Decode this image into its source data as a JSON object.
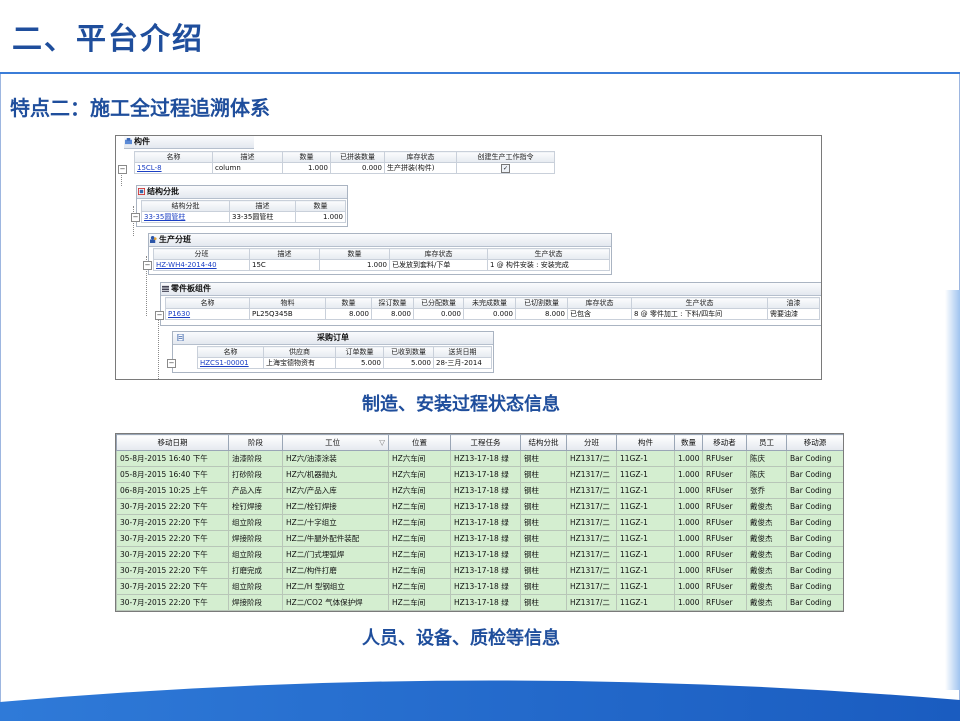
{
  "slide": {
    "title": "二、平台介绍",
    "subtitle": "特点二：施工全过程追溯体系",
    "caption1": "制造、安装过程状态信息",
    "caption2": "人员、设备、质检等信息"
  },
  "s1": {
    "component": {
      "title": "构件",
      "headers": [
        "名称",
        "描述",
        "数量",
        "已拼装数量",
        "库存状态",
        "创建生产工作指令"
      ],
      "row": [
        "15CL-8",
        "column",
        "1.000",
        "0.000",
        "生产拼装(构件)",
        "✓"
      ]
    },
    "batch": {
      "title": "结构分批",
      "headers": [
        "结构分批",
        "描述",
        "数量"
      ],
      "row": [
        "33-35圆管柱",
        "33-35圆管柱",
        "1.000"
      ]
    },
    "team": {
      "title": "生产分班",
      "headers": [
        "分班",
        "描述",
        "数量",
        "库存状态",
        "生产状态"
      ],
      "row": [
        "HZ-WH4-2014-40",
        "15C",
        "1.000",
        "已发放到套料/下单",
        "1 @ 构件安装 : 安装完成"
      ]
    },
    "part": {
      "title": "零件板组件",
      "headers": [
        "名称",
        "物料",
        "数量",
        "採订数量",
        "已分配数量",
        "未完成数量",
        "已切割数量",
        "库存状态",
        "生产状态",
        "油漆"
      ],
      "row": [
        "P1630",
        "PL25Q345B",
        "8.000",
        "8.000",
        "0.000",
        "0.000",
        "8.000",
        "已包含",
        "8 @ 零件加工 : 下料/四车间",
        "需要油漆"
      ]
    },
    "po": {
      "title": "采购订单",
      "headers": [
        "名称",
        "供应商",
        "订单数量",
        "已收到数量",
        "送货日期"
      ],
      "row": [
        "HZCS1-00001",
        "上海宝德物资有",
        "5.000",
        "5.000",
        "28-三月-2014"
      ]
    }
  },
  "s2": {
    "headers": [
      "移动日期",
      "阶段",
      "工位",
      "位置",
      "工程任务",
      "结构分批",
      "分班",
      "构件",
      "数量",
      "移动者",
      "员工",
      "移动源"
    ],
    "rows": [
      [
        "05-8月-2015 16:40 下午",
        "油漆阶段",
        "HZ六/油漆涂装",
        "HZ六车间",
        "HZ13-17-18 绿",
        "钢柱",
        "HZ1317/二",
        "11GZ-1",
        "1.000",
        "RFUser",
        "陈庆",
        "Bar Coding"
      ],
      [
        "05-8月-2015 16:40 下午",
        "打砂阶段",
        "HZ六/机器抛丸",
        "HZ六车间",
        "HZ13-17-18 绿",
        "钢柱",
        "HZ1317/二",
        "11GZ-1",
        "1.000",
        "RFUser",
        "陈庆",
        "Bar Coding"
      ],
      [
        "06-8月-2015 10:25 上午",
        "产品入库",
        "HZ六/产品入库",
        "HZ六车间",
        "HZ13-17-18 绿",
        "钢柱",
        "HZ1317/二",
        "11GZ-1",
        "1.000",
        "RFUser",
        "张乔",
        "Bar Coding"
      ],
      [
        "30-7月-2015 22:20 下午",
        "栓钉焊接",
        "HZ二/栓钉焊接",
        "HZ二车间",
        "HZ13-17-18 绿",
        "钢柱",
        "HZ1317/二",
        "11GZ-1",
        "1.000",
        "RFUser",
        "戴俊杰",
        "Bar Coding"
      ],
      [
        "30-7月-2015 22:20 下午",
        "组立阶段",
        "HZ二/十字组立",
        "HZ二车间",
        "HZ13-17-18 绿",
        "钢柱",
        "HZ1317/二",
        "11GZ-1",
        "1.000",
        "RFUser",
        "戴俊杰",
        "Bar Coding"
      ],
      [
        "30-7月-2015 22:20 下午",
        "焊接阶段",
        "HZ二/牛腿外配件装配",
        "HZ二车间",
        "HZ13-17-18 绿",
        "钢柱",
        "HZ1317/二",
        "11GZ-1",
        "1.000",
        "RFUser",
        "戴俊杰",
        "Bar Coding"
      ],
      [
        "30-7月-2015 22:20 下午",
        "组立阶段",
        "HZ二/门式埋弧焊",
        "HZ二车间",
        "HZ13-17-18 绿",
        "钢柱",
        "HZ1317/二",
        "11GZ-1",
        "1.000",
        "RFUser",
        "戴俊杰",
        "Bar Coding"
      ],
      [
        "30-7月-2015 22:20 下午",
        "打磨完成",
        "HZ二/构件打磨",
        "HZ二车间",
        "HZ13-17-18 绿",
        "钢柱",
        "HZ1317/二",
        "11GZ-1",
        "1.000",
        "RFUser",
        "戴俊杰",
        "Bar Coding"
      ],
      [
        "30-7月-2015 22:20 下午",
        "组立阶段",
        "HZ二/H 型钢组立",
        "HZ二车间",
        "HZ13-17-18 绿",
        "钢柱",
        "HZ1317/二",
        "11GZ-1",
        "1.000",
        "RFUser",
        "戴俊杰",
        "Bar Coding"
      ],
      [
        "30-7月-2015 22:20 下午",
        "焊接阶段",
        "HZ二/CO2 气体保护焊",
        "HZ二车间",
        "HZ13-17-18 绿",
        "钢柱",
        "HZ1317/二",
        "11GZ-1",
        "1.000",
        "RFUser",
        "戴俊杰",
        "Bar Coding"
      ]
    ]
  },
  "colors": {
    "title": "#1f4e9c",
    "row_green": "#d4eed0",
    "link": "#1b3fc4"
  }
}
